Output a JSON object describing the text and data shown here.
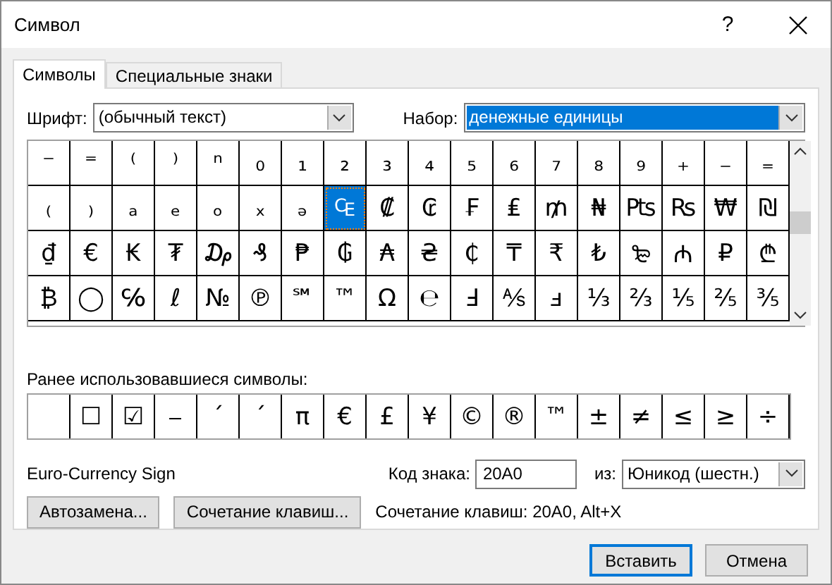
{
  "window": {
    "title": "Символ",
    "help": "?"
  },
  "tabs": [
    {
      "label": "Символы",
      "selected": true
    },
    {
      "label": "Специальные знаки",
      "selected": false
    }
  ],
  "font": {
    "label": "Шрифт:",
    "value": "(обычный текст)"
  },
  "subset": {
    "label": "Набор:",
    "value": "денежные единицы",
    "focused": true
  },
  "symbols": [
    [
      {
        "symbol": "⁻",
        "selected": false
      },
      {
        "symbol": "⁼",
        "selected": false
      },
      {
        "symbol": "⁽",
        "selected": false
      },
      {
        "symbol": "⁾",
        "selected": false
      },
      {
        "symbol": "ⁿ",
        "selected": false
      },
      {
        "symbol": "₀",
        "selected": false
      },
      {
        "symbol": "₁",
        "selected": false
      },
      {
        "symbol": "₂",
        "selected": false
      },
      {
        "symbol": "₃",
        "selected": false
      },
      {
        "symbol": "₄",
        "selected": false
      },
      {
        "symbol": "₅",
        "selected": false
      },
      {
        "symbol": "₆",
        "selected": false
      },
      {
        "symbol": "₇",
        "selected": false
      },
      {
        "symbol": "₈",
        "selected": false
      },
      {
        "symbol": "₉",
        "selected": false
      },
      {
        "symbol": "₊",
        "selected": false
      },
      {
        "symbol": "₋",
        "selected": false
      },
      {
        "symbol": "₌",
        "selected": false
      }
    ],
    [
      {
        "symbol": "₍",
        "selected": false
      },
      {
        "symbol": "₎",
        "selected": false
      },
      {
        "symbol": "ₐ",
        "selected": false
      },
      {
        "symbol": "ₑ",
        "selected": false
      },
      {
        "symbol": "ₒ",
        "selected": false
      },
      {
        "symbol": "ₓ",
        "selected": false
      },
      {
        "symbol": "ₔ",
        "selected": false
      },
      {
        "symbol": "₠",
        "selected": true
      },
      {
        "symbol": "₡",
        "selected": false
      },
      {
        "symbol": "₢",
        "selected": false
      },
      {
        "symbol": "₣",
        "selected": false
      },
      {
        "symbol": "₤",
        "selected": false
      },
      {
        "symbol": "₥",
        "selected": false
      },
      {
        "symbol": "₦",
        "selected": false
      },
      {
        "symbol": "₧",
        "selected": false
      },
      {
        "symbol": "₨",
        "selected": false
      },
      {
        "symbol": "₩",
        "selected": false
      },
      {
        "symbol": "₪",
        "selected": false
      }
    ],
    [
      {
        "symbol": "₫",
        "selected": false
      },
      {
        "symbol": "€",
        "selected": false
      },
      {
        "symbol": "₭",
        "selected": false
      },
      {
        "symbol": "₮",
        "selected": false
      },
      {
        "symbol": "₯",
        "selected": false
      },
      {
        "symbol": "₰",
        "selected": false
      },
      {
        "symbol": "₱",
        "selected": false
      },
      {
        "symbol": "₲",
        "selected": false
      },
      {
        "symbol": "₳",
        "selected": false
      },
      {
        "symbol": "₴",
        "selected": false
      },
      {
        "symbol": "₵",
        "selected": false
      },
      {
        "symbol": "₸",
        "selected": false
      },
      {
        "symbol": "₹",
        "selected": false
      },
      {
        "symbol": "₺",
        "selected": false
      },
      {
        "symbol": "₻",
        "selected": false
      },
      {
        "symbol": "₼",
        "selected": false
      },
      {
        "symbol": "₽",
        "selected": false
      },
      {
        "symbol": "₾",
        "selected": false
      }
    ],
    [
      {
        "symbol": "₿",
        "selected": false
      },
      {
        "symbol": "◯",
        "selected": false
      },
      {
        "symbol": "℅",
        "selected": false
      },
      {
        "symbol": "ℓ",
        "selected": false
      },
      {
        "symbol": "№",
        "selected": false
      },
      {
        "symbol": "℗",
        "selected": false
      },
      {
        "symbol": "℠",
        "selected": false
      },
      {
        "symbol": "™",
        "selected": false
      },
      {
        "symbol": "Ω",
        "selected": false
      },
      {
        "symbol": "℮",
        "selected": false
      },
      {
        "symbol": "Ⅎ",
        "selected": false
      },
      {
        "symbol": "⅍",
        "selected": false
      },
      {
        "symbol": "ⅎ",
        "selected": false
      },
      {
        "symbol": "⅓",
        "selected": false
      },
      {
        "symbol": "⅔",
        "selected": false
      },
      {
        "symbol": "⅕",
        "selected": false
      },
      {
        "symbol": "⅖",
        "selected": false
      },
      {
        "symbol": "⅗",
        "selected": false
      }
    ]
  ],
  "recent": {
    "label": "Ранее использовавшиеся символы:",
    "items": [
      {
        "kind": "empty"
      },
      {
        "kind": "symbol",
        "symbol": "☐"
      },
      {
        "kind": "symbol",
        "symbol": "☑"
      },
      {
        "kind": "symbol",
        "symbol": "⎯"
      },
      {
        "kind": "symbol",
        "symbol": "´"
      },
      {
        "kind": "symbol",
        "symbol": "ˊ"
      },
      {
        "kind": "symbol",
        "symbol": "π"
      },
      {
        "kind": "symbol",
        "symbol": "€"
      },
      {
        "kind": "symbol",
        "symbol": "£"
      },
      {
        "kind": "symbol",
        "symbol": "¥"
      },
      {
        "kind": "symbol",
        "symbol": "©"
      },
      {
        "kind": "symbol",
        "symbol": "®"
      },
      {
        "kind": "symbol",
        "symbol": "™"
      },
      {
        "kind": "symbol",
        "symbol": "±"
      },
      {
        "kind": "symbol",
        "symbol": "≠"
      },
      {
        "kind": "symbol",
        "symbol": "≤"
      },
      {
        "kind": "symbol",
        "symbol": "≥"
      },
      {
        "kind": "symbol",
        "symbol": "÷"
      }
    ]
  },
  "symbol_name": "Euro-Currency Sign",
  "code": {
    "label": "Код знака:",
    "value": "20A0"
  },
  "from": {
    "label": "из:",
    "value": "Юникод (шестн.)"
  },
  "buttons": [
    "Автозамена...",
    "Сочетание клавиш..."
  ],
  "shortcut": "Сочетание клавиш: 20A0, Alt+X",
  "footer_buttons": [
    {
      "label": "Вставить",
      "default": true
    },
    {
      "label": "Отмена",
      "default": false
    }
  ]
}
